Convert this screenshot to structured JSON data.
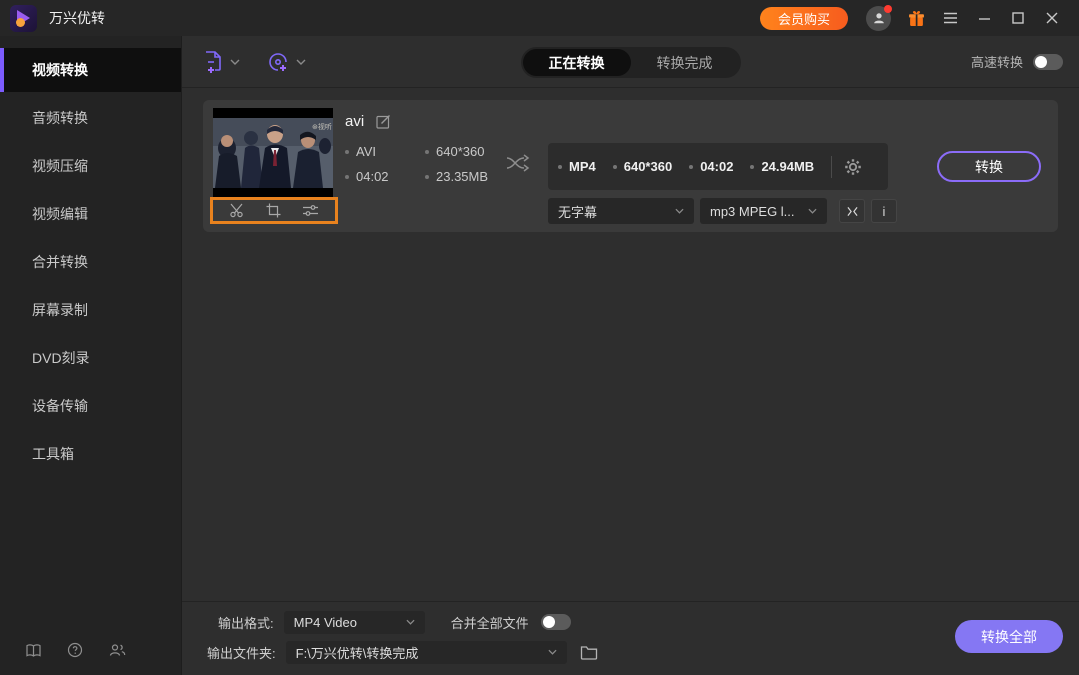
{
  "titlebar": {
    "app_title": "万兴优转",
    "buy_button": "会员购买"
  },
  "sidebar": {
    "items": [
      "视频转换",
      "音频转换",
      "视频压缩",
      "视频编辑",
      "合并转换",
      "屏幕录制",
      "DVD刻录",
      "设备传输",
      "工具箱"
    ],
    "active_index": 0
  },
  "header": {
    "tabs": [
      "正在转换",
      "转换完成"
    ],
    "active_tab": 0,
    "fast_convert_label": "高速转换",
    "fast_convert_on": false
  },
  "file_row": {
    "filename": "avi",
    "source": {
      "format": "AVI",
      "resolution": "640*360",
      "duration": "04:02",
      "size": "23.35MB"
    },
    "output": {
      "format": "MP4",
      "resolution": "640*360",
      "duration": "04:02",
      "size": "24.94MB"
    },
    "subtitle_dropdown": "无字幕",
    "audio_dropdown": "mp3 MPEG l...",
    "info_button": "i",
    "convert_button": "转换"
  },
  "bottom_bar": {
    "output_format_label": "输出格式:",
    "output_format_value": "MP4 Video",
    "merge_label": "合并全部文件",
    "merge_on": false,
    "output_folder_label": "输出文件夹:",
    "output_folder_value": "F:\\万兴优转\\转换完成",
    "convert_all_button": "转换全部"
  },
  "colors": {
    "accent_purple": "#7c5cfe",
    "button_purple": "#8577f3",
    "orange": "#f7661d",
    "highlight_border": "#e8821e",
    "background": "#2e2e2e"
  }
}
